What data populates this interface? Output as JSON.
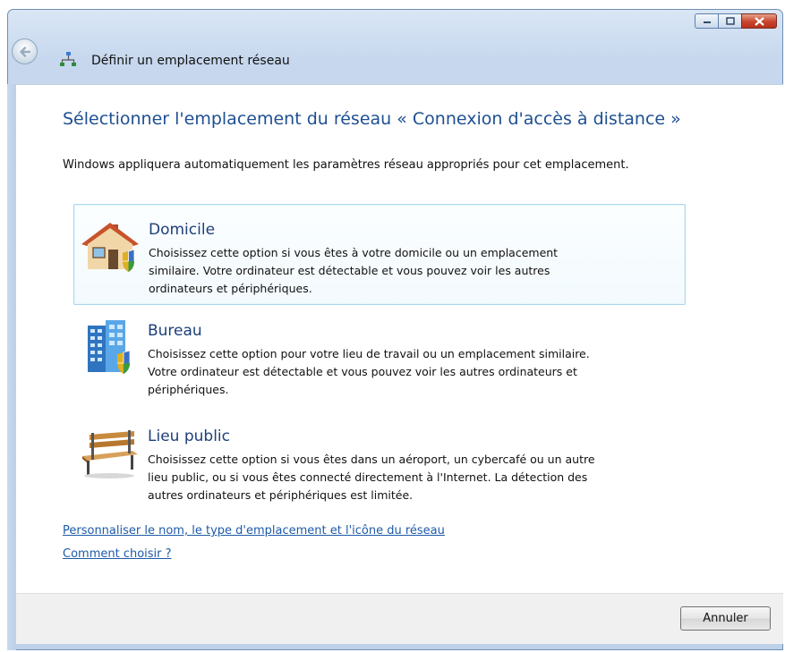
{
  "window": {
    "title": "Définir un emplacement réseau",
    "titlebar_buttons": [
      "minimize-icon",
      "maximize-icon",
      "close-icon"
    ]
  },
  "page": {
    "heading": "Sélectionner l'emplacement du réseau « Connexion d'accès à distance »",
    "intro": "Windows appliquera automatiquement les paramètres réseau appropriés pour cet emplacement."
  },
  "options": [
    {
      "icon": "house-icon",
      "title": "Domicile",
      "lines": [
        "Choisissez cette option si vous êtes à votre domicile ou un emplacement",
        "similaire. Votre ordinateur est détectable et vous pouvez voir les autres",
        "ordinateurs et périphériques."
      ],
      "selected": true
    },
    {
      "icon": "office-building-icon",
      "title": "Bureau",
      "lines": [
        "Choisissez cette option pour votre lieu de travail ou un emplacement similaire.",
        "Votre ordinateur est détectable et vous pouvez voir les autres ordinateurs et",
        "périphériques."
      ],
      "selected": false
    },
    {
      "icon": "park-bench-icon",
      "title": "Lieu public",
      "lines": [
        "Choisissez cette option si vous êtes dans un aéroport, un cybercafé ou un autre",
        "lieu public, ou si vous êtes connecté directement à l'Internet. La détection des",
        "autres ordinateurs et périphériques est limitée."
      ],
      "selected": false
    }
  ],
  "links": {
    "customize": "Personnaliser le nom, le type d'emplacement et l'icône du réseau",
    "help": "Comment choisir ?"
  },
  "footer": {
    "cancel_label": "Annuler"
  },
  "colors": {
    "heading": "#1e4f91",
    "link": "#1e5aa8",
    "selection_border": "#a8d7ef"
  }
}
